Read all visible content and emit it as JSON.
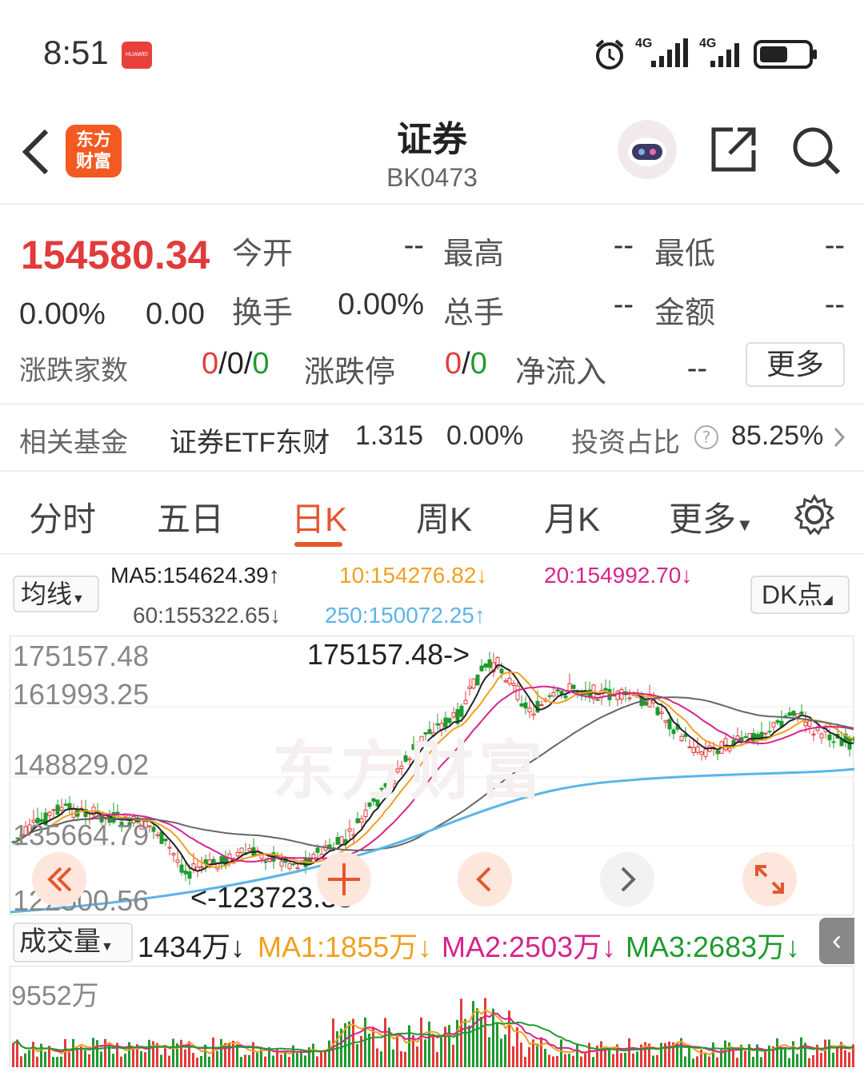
{
  "status_bar": {
    "time": "8:51",
    "badge_text": "HUAWEI",
    "network_1": "4G",
    "network_2": "4G"
  },
  "header": {
    "logo_line1": "东方",
    "logo_line2": "财富",
    "title": "证券",
    "code": "BK0473"
  },
  "quote": {
    "price": "154580.34",
    "change_pct": "0.00%",
    "change_val": "0.00",
    "open_label": "今开",
    "open_val": "--",
    "high_label": "最高",
    "high_val": "--",
    "low_label": "最低",
    "low_val": "--",
    "turnover_label": "换手",
    "turnover_val": "0.00%",
    "volume_label": "总手",
    "volume_val": "--",
    "amount_label": "金额",
    "amount_val": "--",
    "updown_label": "涨跌家数",
    "updown_up": "0",
    "updown_sep1": "/",
    "updown_flat": "0",
    "updown_sep2": "/",
    "updown_down": "0",
    "limit_label": "涨跌停",
    "limit_up": "0",
    "limit_sep": "/",
    "limit_down": "0",
    "inflow_label": "净流入",
    "inflow_val": "--",
    "more_button": "更多"
  },
  "fund": {
    "label": "相关基金",
    "name": "证券ETF东财",
    "price": "1.315",
    "pct": "0.00%",
    "ratio_label": "投资占比",
    "ratio_val": "85.25%"
  },
  "tabs": [
    "分时",
    "五日",
    "日K",
    "周K",
    "月K",
    "更多"
  ],
  "active_tab": "日K",
  "ma": {
    "selector": "均线",
    "ma5": "MA5:154624.39↑",
    "ma10": "10:154276.82↓",
    "ma20": "20:154992.70↓",
    "ma60": "60:155322.65↓",
    "ma250": "250:150072.25↑",
    "dk_button": "DK点",
    "colors": {
      "ma5": "#222222",
      "ma10": "#f0a020",
      "ma20": "#d6248c",
      "ma60": "#666666",
      "ma250": "#5bb5e8"
    }
  },
  "kline": {
    "axis": [
      "175157.48",
      "161993.25",
      "148829.02",
      "135664.79",
      "122500.56"
    ],
    "high_marker": "175157.48->",
    "low_marker": "<-123723.38",
    "watermark": "东方财富"
  },
  "volume": {
    "selector": "成交量",
    "current": "1434万↓",
    "ma1": "MA1:1855万↓",
    "ma2": "MA2:2503万↓",
    "ma3": "MA3:2683万↓",
    "axis_top": "9552万",
    "colors": {
      "ma1": "#f0a020",
      "ma2": "#d6248c",
      "ma3": "#1f9b2e"
    }
  }
}
